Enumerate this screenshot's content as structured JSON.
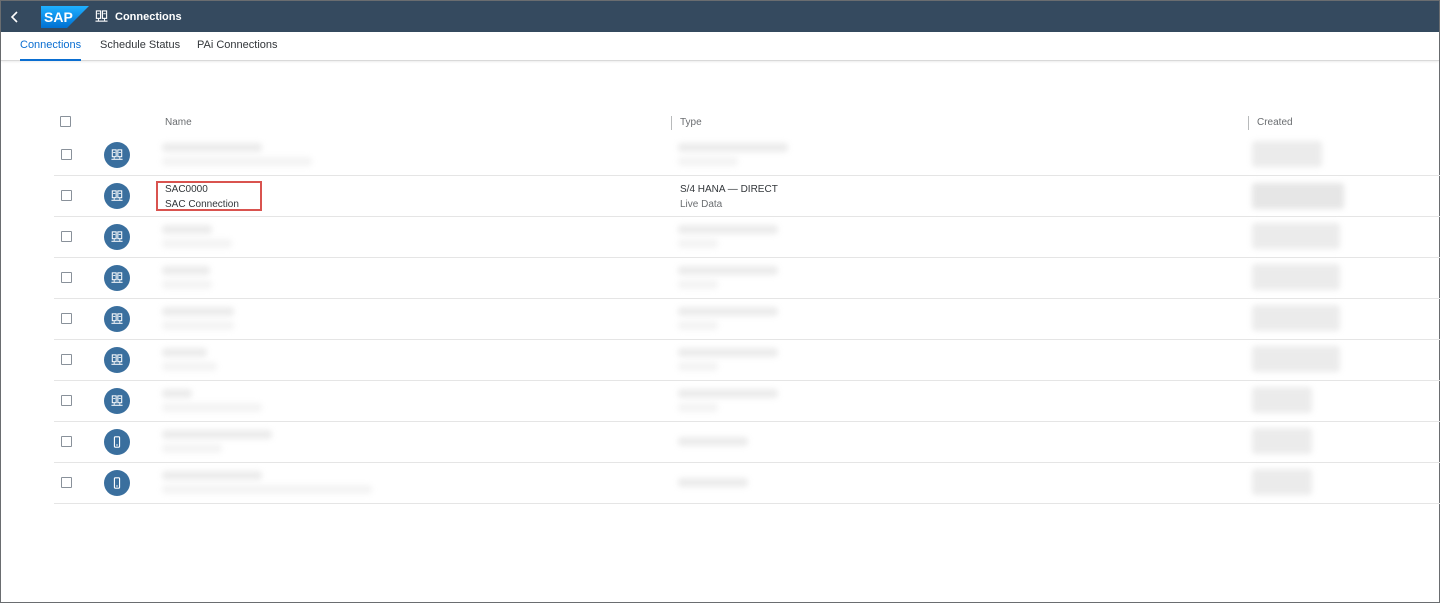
{
  "shell": {
    "logo_text": "SAP",
    "title": "Connections"
  },
  "tabs": [
    {
      "label": "Connections",
      "active": true
    },
    {
      "label": "Schedule Status",
      "active": false
    },
    {
      "label": "PAi Connections",
      "active": false
    }
  ],
  "table": {
    "columns": {
      "name": "Name",
      "type": "Type",
      "created": "Created"
    },
    "rows": [
      {
        "icon": "connection-icon",
        "name": "",
        "description": "",
        "type": "",
        "type_detail": "",
        "blurred": true
      },
      {
        "icon": "connection-icon",
        "name": "SAC0000",
        "description": "SAC Connection",
        "type": "S/4 HANA — DIRECT",
        "type_detail": "Live Data",
        "blurred": false,
        "highlighted": true
      },
      {
        "icon": "connection-icon",
        "name": "",
        "description": "",
        "type": "",
        "type_detail": "",
        "blurred": true
      },
      {
        "icon": "connection-icon",
        "name": "",
        "description": "",
        "type": "",
        "type_detail": "",
        "blurred": true
      },
      {
        "icon": "connection-icon",
        "name": "",
        "description": "",
        "type": "",
        "type_detail": "",
        "blurred": true
      },
      {
        "icon": "connection-icon",
        "name": "",
        "description": "",
        "type": "",
        "type_detail": "",
        "blurred": true
      },
      {
        "icon": "connection-icon",
        "name": "",
        "description": "",
        "type": "",
        "type_detail": "",
        "blurred": true
      },
      {
        "icon": "mobile-icon",
        "name": "",
        "description": "",
        "type": "",
        "type_detail": "",
        "blurred": true
      },
      {
        "icon": "mobile-icon",
        "name": "",
        "description": "",
        "type": "",
        "type_detail": "",
        "blurred": true
      }
    ]
  },
  "colors": {
    "shell_bg": "#354a5f",
    "accent": "#0a6ed1",
    "avatar_bg": "#3a6f9e",
    "highlight": "#d9534f"
  }
}
